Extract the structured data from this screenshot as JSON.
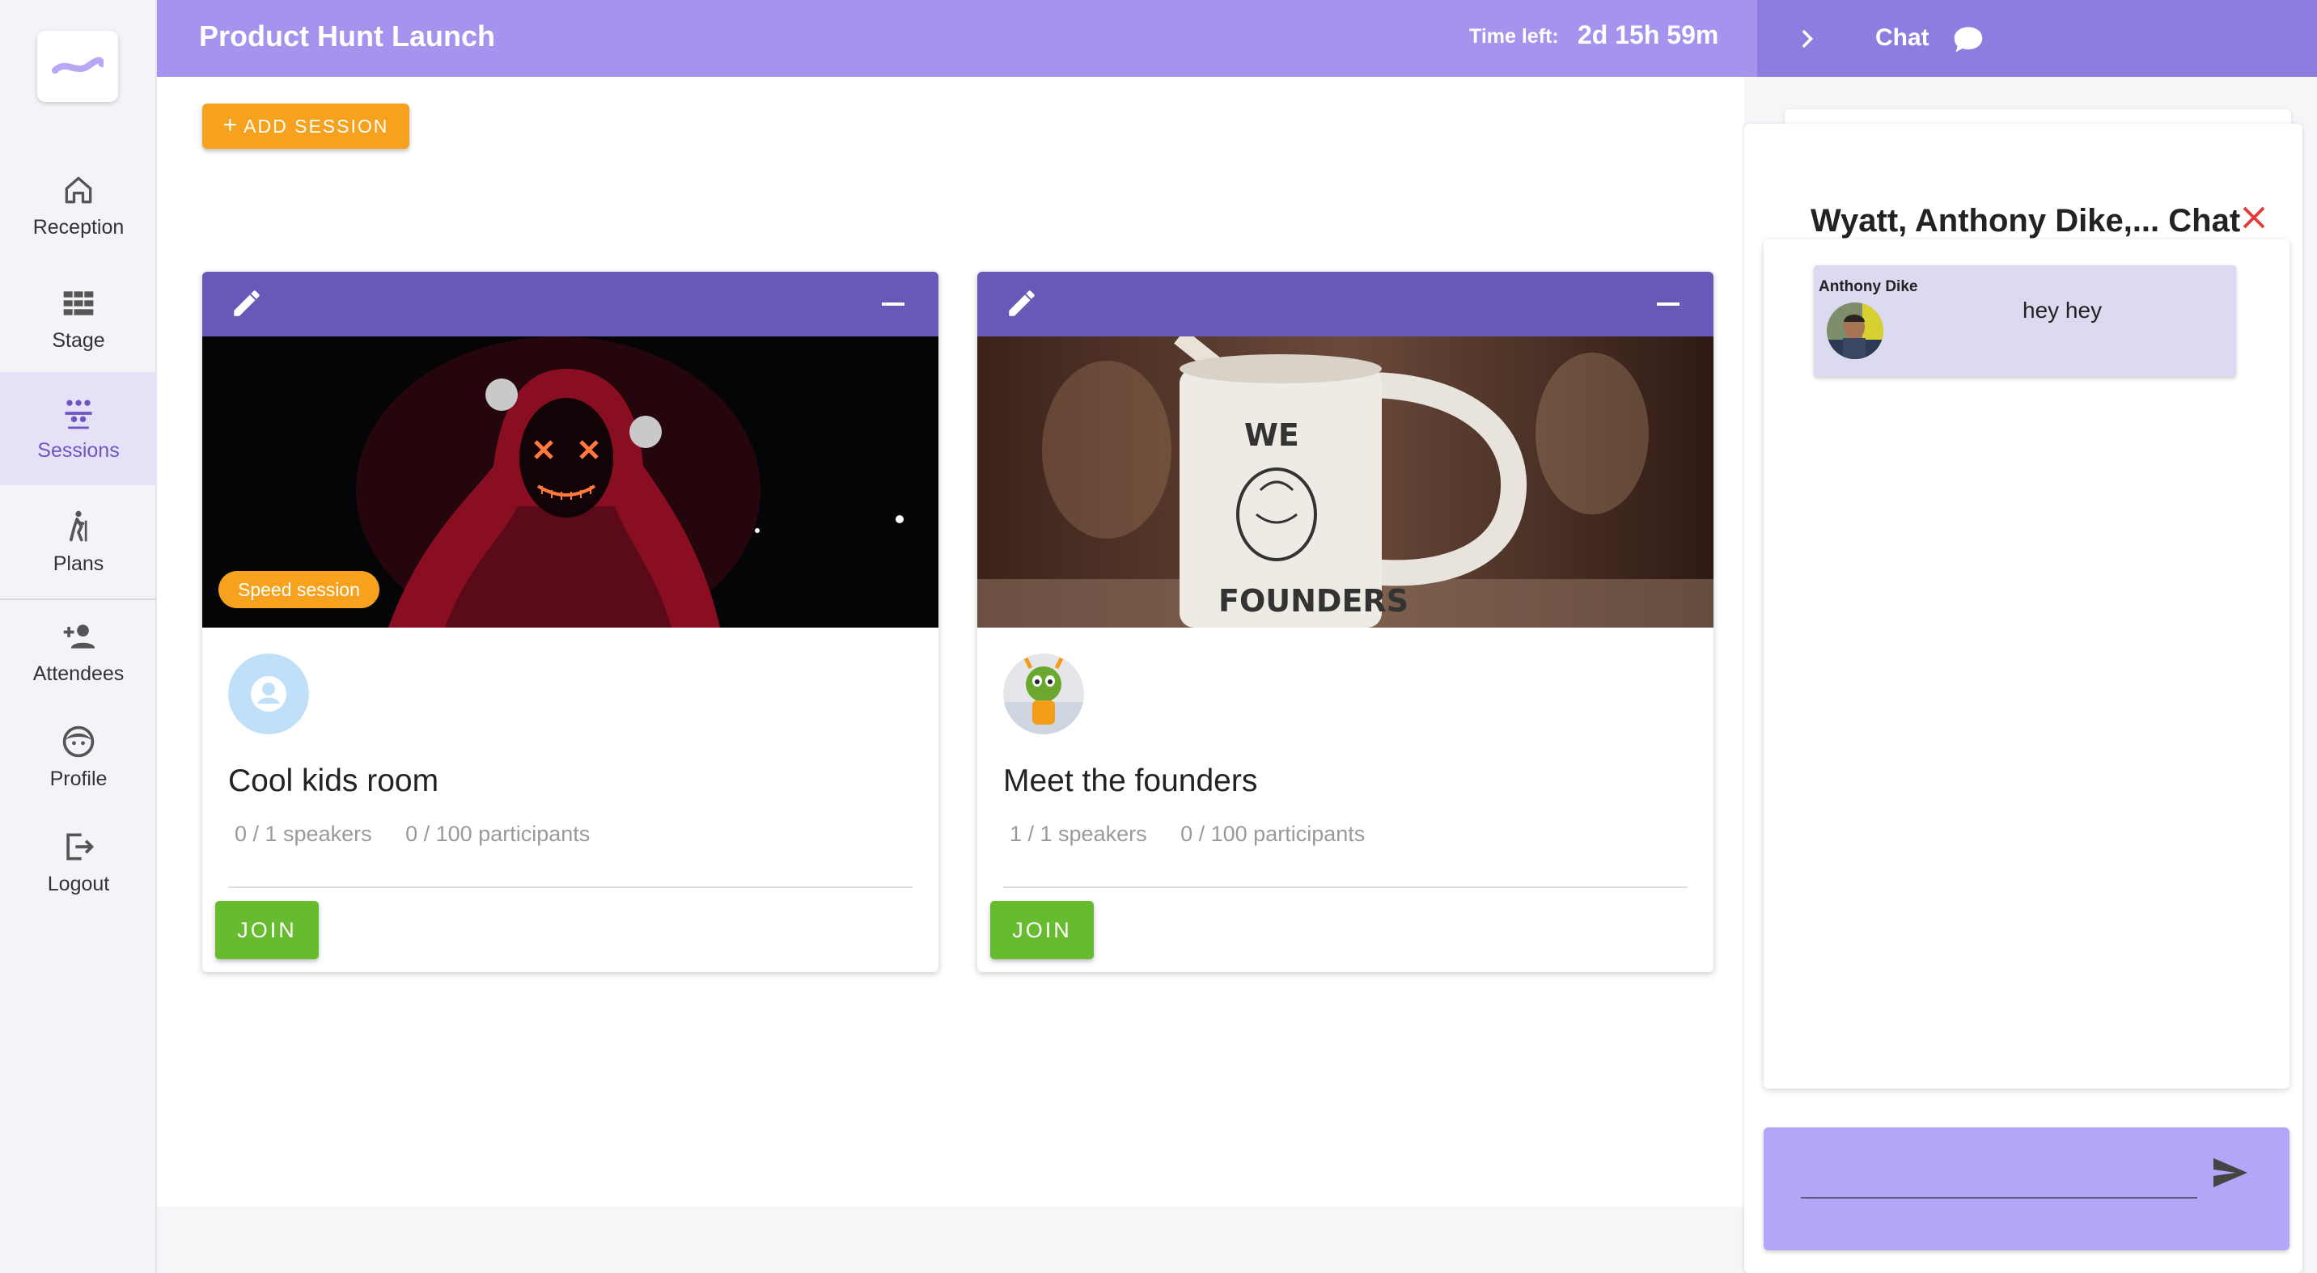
{
  "app": {
    "title": "Product Hunt Launch",
    "time_left_label": "Time left:",
    "time_left_value": "2d 15h 59m"
  },
  "sidebar": {
    "items": [
      {
        "label": "Reception",
        "icon": "home-icon"
      },
      {
        "label": "Stage",
        "icon": "stage-grid-icon"
      },
      {
        "label": "Sessions",
        "icon": "people-group-icon",
        "active": true
      },
      {
        "label": "Plans",
        "icon": "hiker-icon"
      },
      {
        "label": "Attendees",
        "icon": "person-add-icon"
      },
      {
        "label": "Profile",
        "icon": "face-icon"
      },
      {
        "label": "Logout",
        "icon": "logout-icon"
      }
    ]
  },
  "toolbar": {
    "add_session_label": "ADD SESSION"
  },
  "sessions": [
    {
      "title": "Cool kids room",
      "badge": "Speed session",
      "speakers": "0 / 1 speakers",
      "participants": "0 / 100 participants",
      "join_label": "JOIN"
    },
    {
      "title": "Meet the founders",
      "badge": "",
      "speakers": "1 / 1 speakers",
      "participants": "0 / 100 participants",
      "join_label": "JOIN",
      "mug_line1": "WE",
      "mug_line2": "FOUNDERS"
    }
  ],
  "chat": {
    "header_label": "Chat",
    "title": "Wyatt, Anthony Dike,... Chat",
    "messages": [
      {
        "sender": "Anthony Dike",
        "text": "hey hey"
      }
    ],
    "input_placeholder": ""
  },
  "colors": {
    "header": "#a593ee",
    "chat_header": "#8e7ce0",
    "card_bar": "#6a58b8",
    "accent_orange": "#f6a21e",
    "join_green": "#66bb2e",
    "active_nav": "#6b56c2",
    "close_red": "#e53935"
  }
}
